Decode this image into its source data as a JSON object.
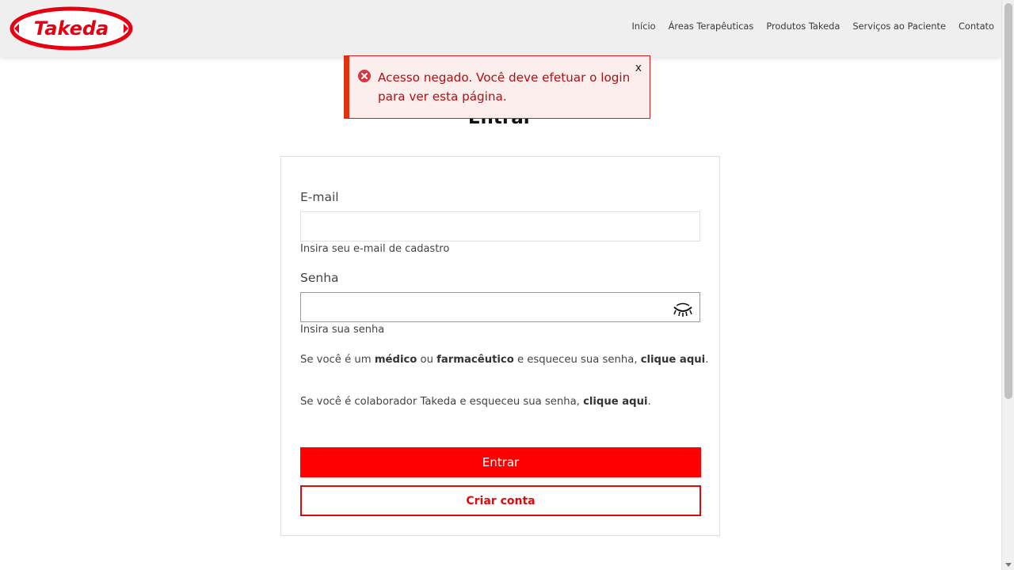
{
  "brand": {
    "logo_text": "Takeda",
    "color": "#e60012"
  },
  "nav": {
    "items": [
      {
        "label": "Início"
      },
      {
        "label": "Áreas Terapêuticas"
      },
      {
        "label": "Produtos Takeda"
      },
      {
        "label": "Serviços ao Paciente"
      },
      {
        "label": "Contato"
      }
    ]
  },
  "alert": {
    "message": "Acesso negado. Você deve efetuar o login para ver esta página.",
    "close_label": "x",
    "icon": "error-circle-icon",
    "color": "#b30f0f"
  },
  "page": {
    "title": "Entrar"
  },
  "form": {
    "email": {
      "label": "E-mail",
      "value": "",
      "help": "Insira seu e-mail de cadastro"
    },
    "password": {
      "label": "Senha",
      "value": "",
      "help": "Insira sua senha",
      "toggle_icon": "eye-closed-icon"
    },
    "info1": {
      "prefix": "Se você é um ",
      "b1": "médico",
      "mid1": " ou ",
      "b2": "farmacêutico",
      "mid2": " e esqueceu sua senha, ",
      "link": "clique aqui",
      "suffix": "."
    },
    "info2": {
      "prefix": "Se você é colaborador Takeda e esqueceu sua senha, ",
      "link": "clique aqui",
      "suffix": "."
    },
    "submit_label": "Entrar",
    "create_label": "Criar conta",
    "primary_color": "#ff0000"
  }
}
